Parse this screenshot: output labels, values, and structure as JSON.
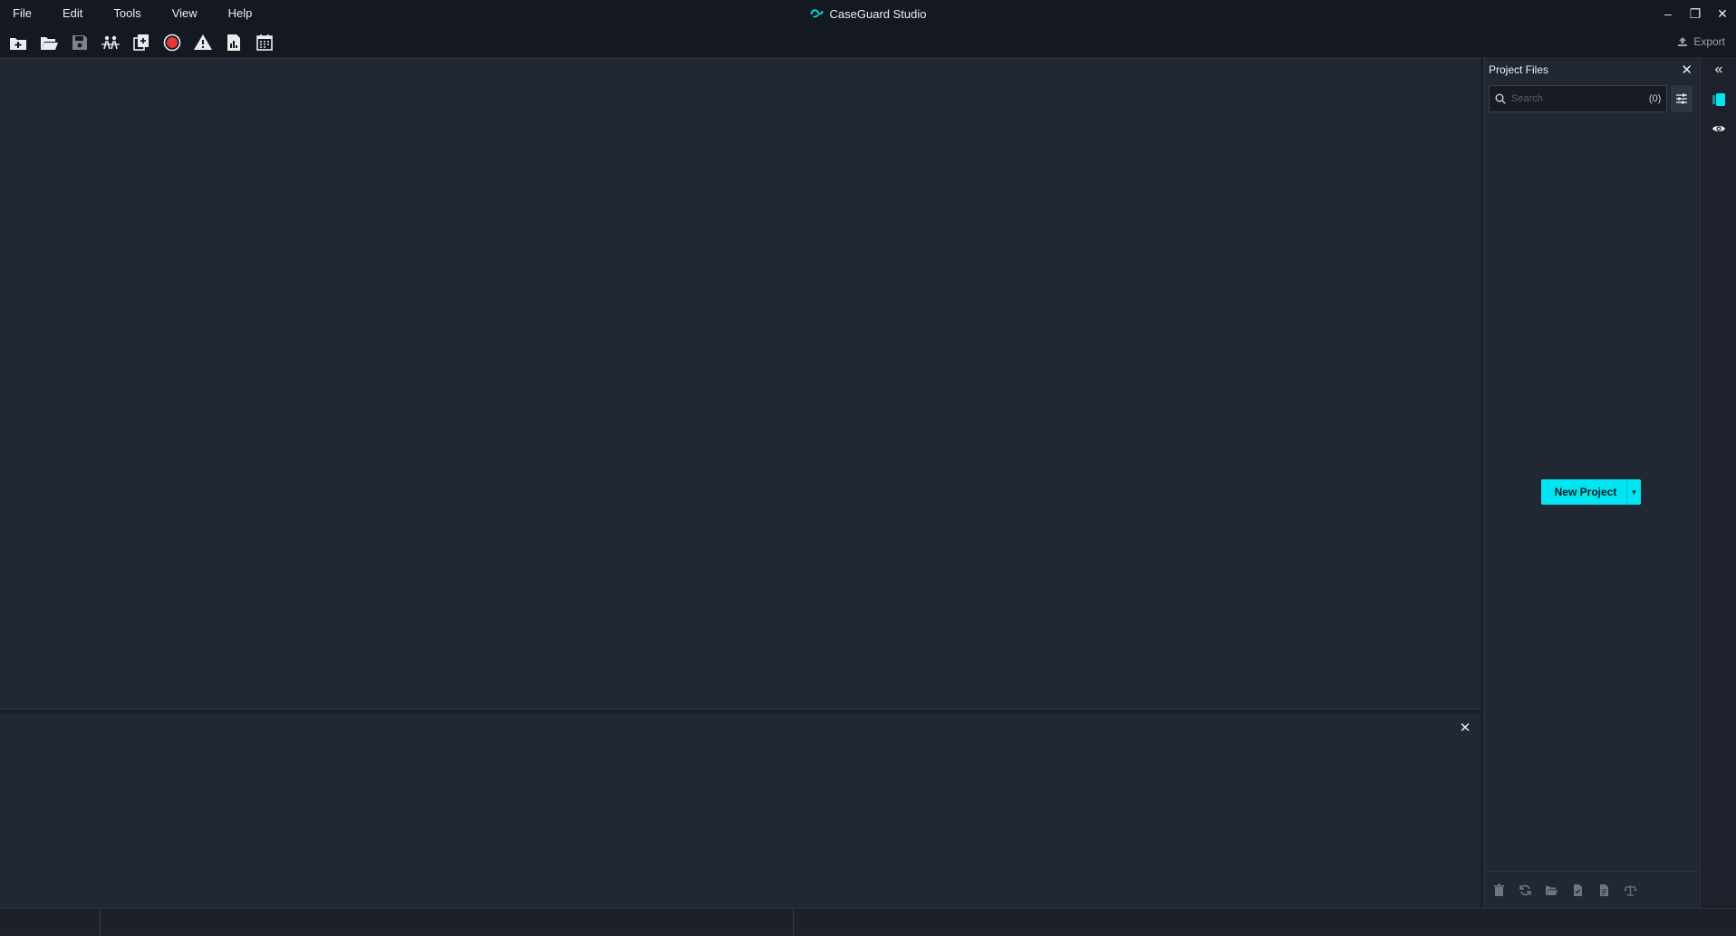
{
  "app": {
    "title": "CaseGuard Studio"
  },
  "menu": {
    "file": "File",
    "edit": "Edit",
    "tools": "Tools",
    "view": "View",
    "help": "Help"
  },
  "window_controls": {
    "minimize": "–",
    "restore": "❐",
    "close": "✕"
  },
  "toolbar": {
    "export_label": "Export",
    "icons": [
      "new-project-icon",
      "open-folder-icon",
      "save-icon",
      "people-tracking-icon",
      "duplicate-icon",
      "record-icon",
      "warning-icon",
      "report-icon",
      "calendar-icon"
    ]
  },
  "project_files": {
    "title": "Project Files",
    "close": "✕",
    "search_placeholder": "Search",
    "count": "(0)",
    "new_project_label": "New Project",
    "new_project_caret": "▾",
    "actions": [
      "delete-icon",
      "refresh-icon",
      "open-folder-icon",
      "file-check-icon",
      "document-icon",
      "balance-scale-icon"
    ]
  },
  "bottom_panel": {
    "close": "✕"
  },
  "right_strip": {
    "collapse": "«",
    "items": [
      "panel-icon",
      "eye-icon"
    ]
  },
  "colors": {
    "accent": "#00e5f2",
    "record": "#e53935",
    "background": "#212733",
    "titlebar": "#141821"
  }
}
